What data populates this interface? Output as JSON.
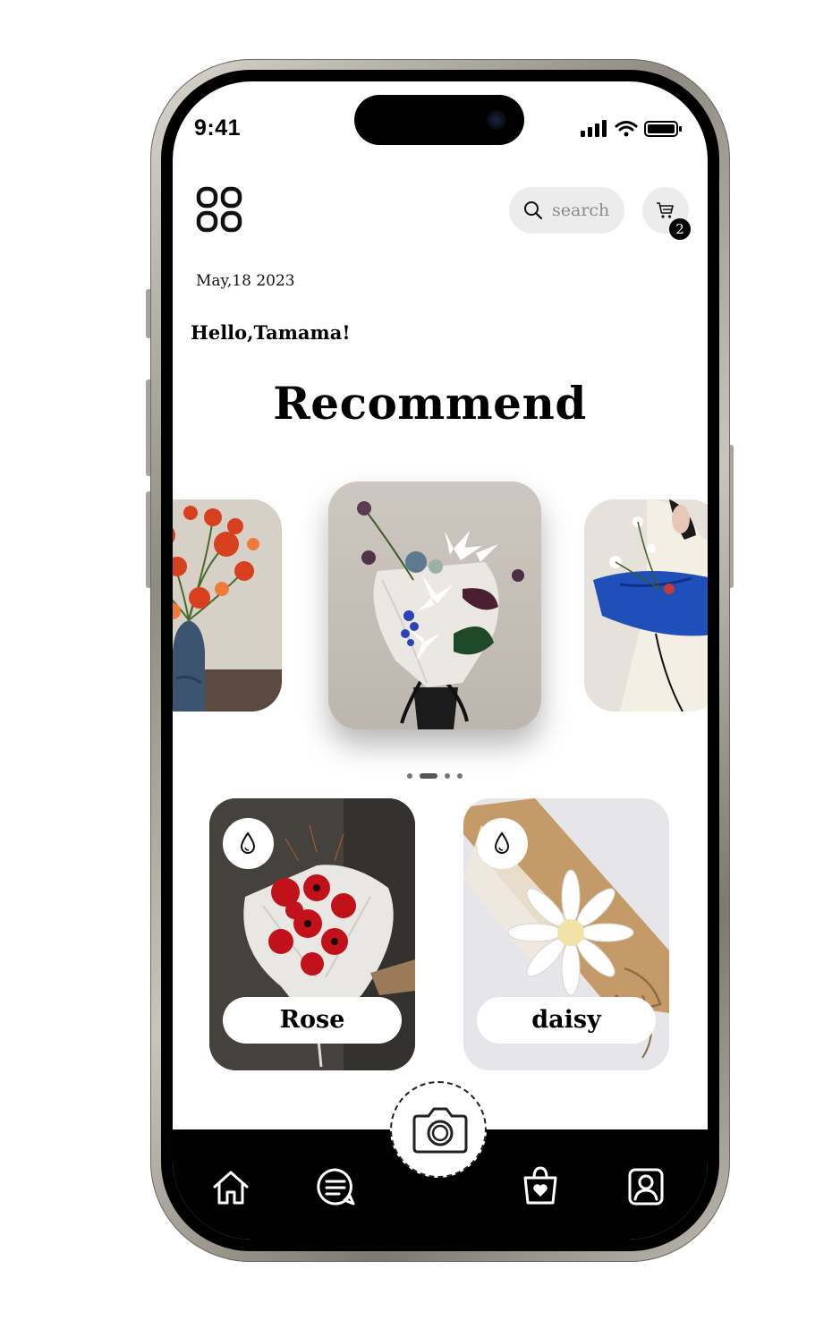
{
  "status_bar": {
    "time": "9:41"
  },
  "header": {
    "menu_icon": "grid-menu-icon",
    "search": {
      "placeholder": "search",
      "icon": "search-icon"
    },
    "cart": {
      "icon": "cart-icon",
      "badge_count": "2"
    }
  },
  "date": "May,18 2023",
  "greeting": "Hello,Tamama!",
  "section_title": "Recommend",
  "carousel": {
    "items": [
      "orange-poppies-vase",
      "white-lily-bouquet",
      "blue-wrapped-bouquet"
    ],
    "active_index": 1,
    "page_count": 4
  },
  "products": [
    {
      "label": "Rose",
      "icon": "water-drop-icon"
    },
    {
      "label": "daisy",
      "icon": "water-drop-icon"
    }
  ],
  "tabbar": {
    "items": [
      "home-icon",
      "chat-icon",
      "camera-icon",
      "shopping-bag-icon",
      "profile-icon"
    ]
  },
  "colors": {
    "accent": "#000000",
    "pill_bg": "#ececec",
    "background": "#ffffff"
  }
}
